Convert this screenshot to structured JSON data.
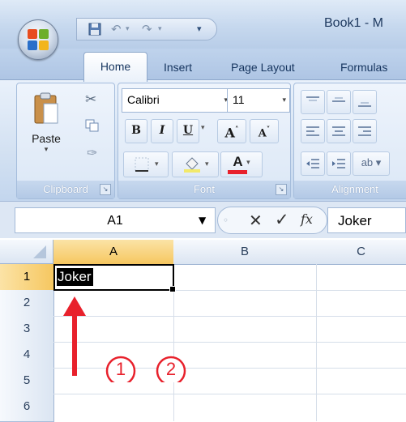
{
  "title": "Book1 - M",
  "tabs": {
    "home": "Home",
    "insert": "Insert",
    "page_layout": "Page Layout",
    "formulas": "Formulas"
  },
  "clipboard": {
    "label": "Clipboard",
    "paste_label": "Paste"
  },
  "font": {
    "label": "Font",
    "name": "Calibri",
    "size": "11",
    "bold": "B",
    "italic": "I",
    "underline": "U",
    "grow": "A",
    "shrink": "A",
    "font_color_letter": "A"
  },
  "alignment": {
    "label": "Alignment"
  },
  "formula_bar": {
    "name_box": "A1",
    "fx": "fx",
    "cancel": "✕",
    "enter": "✓",
    "content": "Joker"
  },
  "grid": {
    "corner": "",
    "columns": [
      "A",
      "B",
      "C"
    ],
    "rows": [
      "1",
      "2",
      "3",
      "4",
      "5",
      "6"
    ],
    "cell_a1": "Joker",
    "selected_cell": "A1"
  },
  "annotation": {
    "circle_1": "1",
    "circle_2": "2"
  },
  "colors": {
    "accent_red": "#e8212c",
    "selection_orange": "#f6c760",
    "ribbon_blue": "#c3d6ee",
    "font_color_bar": "#e8212c"
  }
}
